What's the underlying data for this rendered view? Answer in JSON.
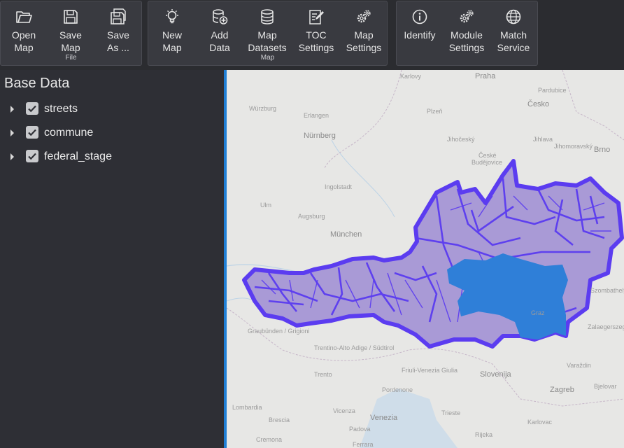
{
  "ribbon": {
    "file": {
      "label": "File",
      "buttons": [
        {
          "line1": "Open",
          "line2": "Map",
          "icon": "folder-open-icon"
        },
        {
          "line1": "Save",
          "line2": "Map",
          "icon": "save-icon"
        },
        {
          "line1": "Save",
          "line2": "As ...",
          "icon": "save-as-icon"
        }
      ]
    },
    "map": {
      "label": "Map",
      "buttons": [
        {
          "line1": "New",
          "line2": "Map",
          "icon": "lightbulb-icon"
        },
        {
          "line1": "Add",
          "line2": "Data",
          "icon": "database-add-icon"
        },
        {
          "line1": "Map",
          "line2": "Datasets",
          "icon": "database-icon"
        },
        {
          "line1": "TOC",
          "line2": "Settings",
          "icon": "edit-document-icon"
        },
        {
          "line1": "Map",
          "line2": "Settings",
          "icon": "gears-icon"
        }
      ]
    },
    "tools": {
      "buttons": [
        {
          "line1": "Identify",
          "line2": "",
          "icon": "info-icon"
        },
        {
          "line1": "Module",
          "line2": "Settings",
          "icon": "gears-icon"
        },
        {
          "line1": "Match",
          "line2": "Service",
          "icon": "globe-icon"
        }
      ]
    }
  },
  "sidebar": {
    "title": "Base Data",
    "layers": [
      {
        "name": "streets",
        "checked": true
      },
      {
        "name": "commune",
        "checked": true
      },
      {
        "name": "federal_stage",
        "checked": true
      }
    ]
  },
  "map": {
    "labels": {
      "praha": "Praha",
      "pardubice": "Pardubice",
      "karlovy": "Karlovy",
      "cesko": "Česko",
      "wurzburg": "Würzburg",
      "erlangen": "Erlangen",
      "plzen": "Plzeň",
      "jihlava": "Jihlava",
      "jihocesky": "Jihočeský",
      "nurnberg": "Nürnberg",
      "ceske": "České",
      "budejovice": "Budějovice",
      "jihomor": "Jihomoravský",
      "brno": "Brno",
      "ingolstadt": "Ingolstadt",
      "augsburg": "Augsburg",
      "ulm": "Ulm",
      "munchen": "München",
      "graz": "Graz",
      "szombathely": "Szombathely",
      "zalaegerszeg": "Zalaegerszeg",
      "graubunden": "Graubünden / Grigioni",
      "trentino": "Trentino-Alto Adige / Südtirol",
      "trento": "Trento",
      "friuli": "Friuli-Venezia Giulia",
      "slovenija": "Slovenija",
      "varazdin": "Varaždin",
      "zagreb": "Zagreb",
      "bjelovar": "Bjelovar",
      "pordenone": "Pordenone",
      "vicenza": "Vicenza",
      "venezia": "Venezia",
      "trieste": "Trieste",
      "padova": "Padova",
      "brescia": "Brescia",
      "cremona": "Cremona",
      "lombardia": "Lombardia",
      "karlovac": "Karlovac",
      "rijeka": "Rijeka",
      "ferrara": "Ferrara"
    }
  },
  "colors": {
    "accent": "#1f7fd6",
    "commune": "#5b3cf0",
    "fill": "#a99ad6",
    "state": "#2f7fd8"
  }
}
